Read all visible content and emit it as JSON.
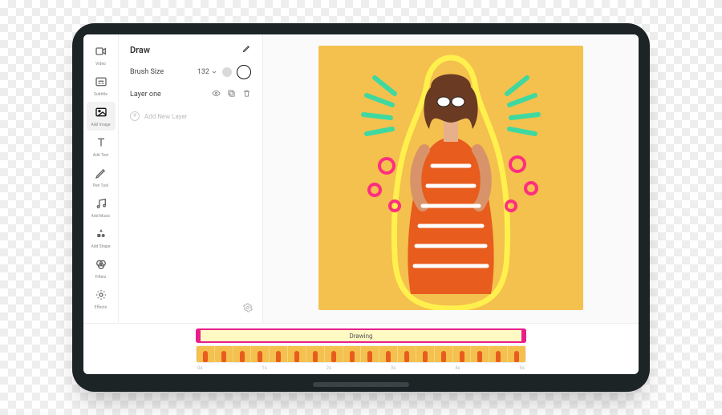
{
  "sidebar": {
    "items": [
      {
        "label": "Video"
      },
      {
        "label": "Subtitle"
      },
      {
        "label": "Add Image"
      },
      {
        "label": "Add Text"
      },
      {
        "label": "Pen Tool"
      },
      {
        "label": "Add Music"
      },
      {
        "label": "Add Shape"
      },
      {
        "label": "Filters"
      },
      {
        "label": "Effects"
      }
    ],
    "active_index": 2
  },
  "panel": {
    "title": "Draw",
    "brush_size_label": "Brush Size",
    "brush_size_value": "132",
    "layer_label": "Layer one",
    "add_label": "Add New Layer"
  },
  "timeline": {
    "track_label": "Drawing",
    "marks": [
      "0s",
      "1s",
      "2s",
      "3s",
      "4s",
      "5s"
    ],
    "thumb_count": 18
  },
  "colors": {
    "accent": "#e91e8c",
    "canvas_bg": "#f4c04e",
    "subject": "#e85c1e",
    "outline": "#fff04d",
    "bursts": "#3fd9a0",
    "doodle": "#ff2e7e"
  }
}
